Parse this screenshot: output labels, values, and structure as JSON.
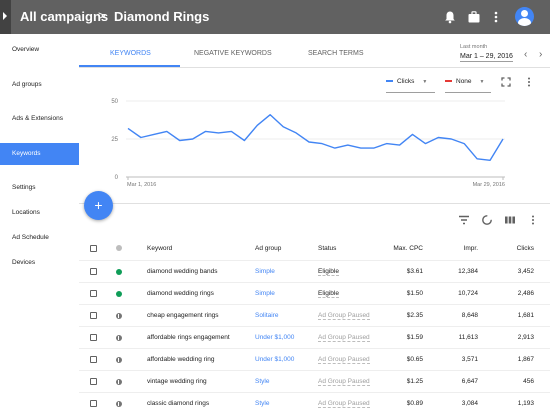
{
  "breadcrumb": {
    "parent": "All campaigns",
    "separator": ">",
    "current": "Diamond Rings"
  },
  "topbar": {
    "icons": [
      "bell-icon",
      "briefcase-icon",
      "more-vert-icon",
      "account-icon"
    ]
  },
  "sidebar": {
    "items": [
      {
        "label": "Overview"
      },
      {
        "label": "Ad groups"
      },
      {
        "label": "Ads & Extensions"
      },
      {
        "label": "Keywords",
        "active": true
      },
      {
        "label": "Settings"
      },
      {
        "label": "Locations"
      },
      {
        "label": "Ad Schedule"
      },
      {
        "label": "Devices"
      }
    ]
  },
  "tabs": [
    {
      "label": "KEYWORDS",
      "active": true
    },
    {
      "label": "NEGATIVE KEYWORDS"
    },
    {
      "label": "SEARCH TERMS"
    }
  ],
  "date_range": {
    "label": "Last month",
    "value": "Mar 1 – 29, 2016"
  },
  "metric_selectors": [
    {
      "label": "Clicks",
      "color": "#4285f4"
    },
    {
      "label": "None",
      "color": "#e53935"
    }
  ],
  "colors": {
    "accent": "#4285f4",
    "topbar": "#616161",
    "status_green": "#0f9d58",
    "status_gray": "#757575"
  },
  "chart_data": {
    "type": "line",
    "title": "",
    "xlabel": "",
    "ylabel": "",
    "ylim": [
      0,
      50
    ],
    "yticks": [
      "0",
      "25",
      "50"
    ],
    "x_tick_labels": [
      "Mar 1, 2016",
      "Mar 29, 2016"
    ],
    "grid": true,
    "series": [
      {
        "name": "Clicks",
        "color": "#4285f4",
        "values": [
          32,
          26,
          28,
          30,
          24,
          25,
          30,
          29,
          30,
          24,
          34,
          41,
          33,
          29,
          23,
          22,
          19,
          21,
          19,
          19,
          22,
          21,
          28,
          22,
          26,
          25,
          22,
          12,
          11,
          25
        ]
      }
    ]
  },
  "fab_label": "+",
  "toolbar_icons": [
    "filter-icon",
    "segment-icon",
    "columns-icon",
    "more-vert-icon"
  ],
  "table": {
    "headers": {
      "keyword": "Keyword",
      "ad_group": "Ad group",
      "status": "Status",
      "max_cpc": "Max. CPC",
      "impr": "Impr.",
      "clicks": "Clicks"
    },
    "rows": [
      {
        "status_icon": "enabled",
        "keyword": "diamond wedding bands",
        "ad_group": "Simple",
        "status": "Eligible",
        "max_cpc": "$3.61",
        "impr": "12,384",
        "clicks": "3,452"
      },
      {
        "status_icon": "enabled",
        "keyword": "diamond wedding rings",
        "ad_group": "Simple",
        "status": "Eligible",
        "max_cpc": "$1.50",
        "impr": "10,724",
        "clicks": "2,486"
      },
      {
        "status_icon": "paused",
        "keyword": "cheap engagement rings",
        "ad_group": "Solitaire",
        "status": "Ad Group Paused",
        "max_cpc": "$2.35",
        "impr": "8,648",
        "clicks": "1,681"
      },
      {
        "status_icon": "paused",
        "keyword": "affordable rings engagement",
        "ad_group": "Under $1,000",
        "status": "Ad Group Paused",
        "max_cpc": "$1.59",
        "impr": "11,613",
        "clicks": "2,913"
      },
      {
        "status_icon": "paused",
        "keyword": "affordable wedding ring",
        "ad_group": "Under $1,000",
        "status": "Ad Group Paused",
        "max_cpc": "$0.65",
        "impr": "3,571",
        "clicks": "1,867"
      },
      {
        "status_icon": "paused",
        "keyword": "vintage wedding ring",
        "ad_group": "Style",
        "status": "Ad Group Paused",
        "max_cpc": "$1.25",
        "impr": "6,647",
        "clicks": "456"
      },
      {
        "status_icon": "paused",
        "keyword": "classic diamond rings",
        "ad_group": "Style",
        "status": "Ad Group Paused",
        "max_cpc": "$0.89",
        "impr": "3,084",
        "clicks": "1,193"
      }
    ]
  }
}
